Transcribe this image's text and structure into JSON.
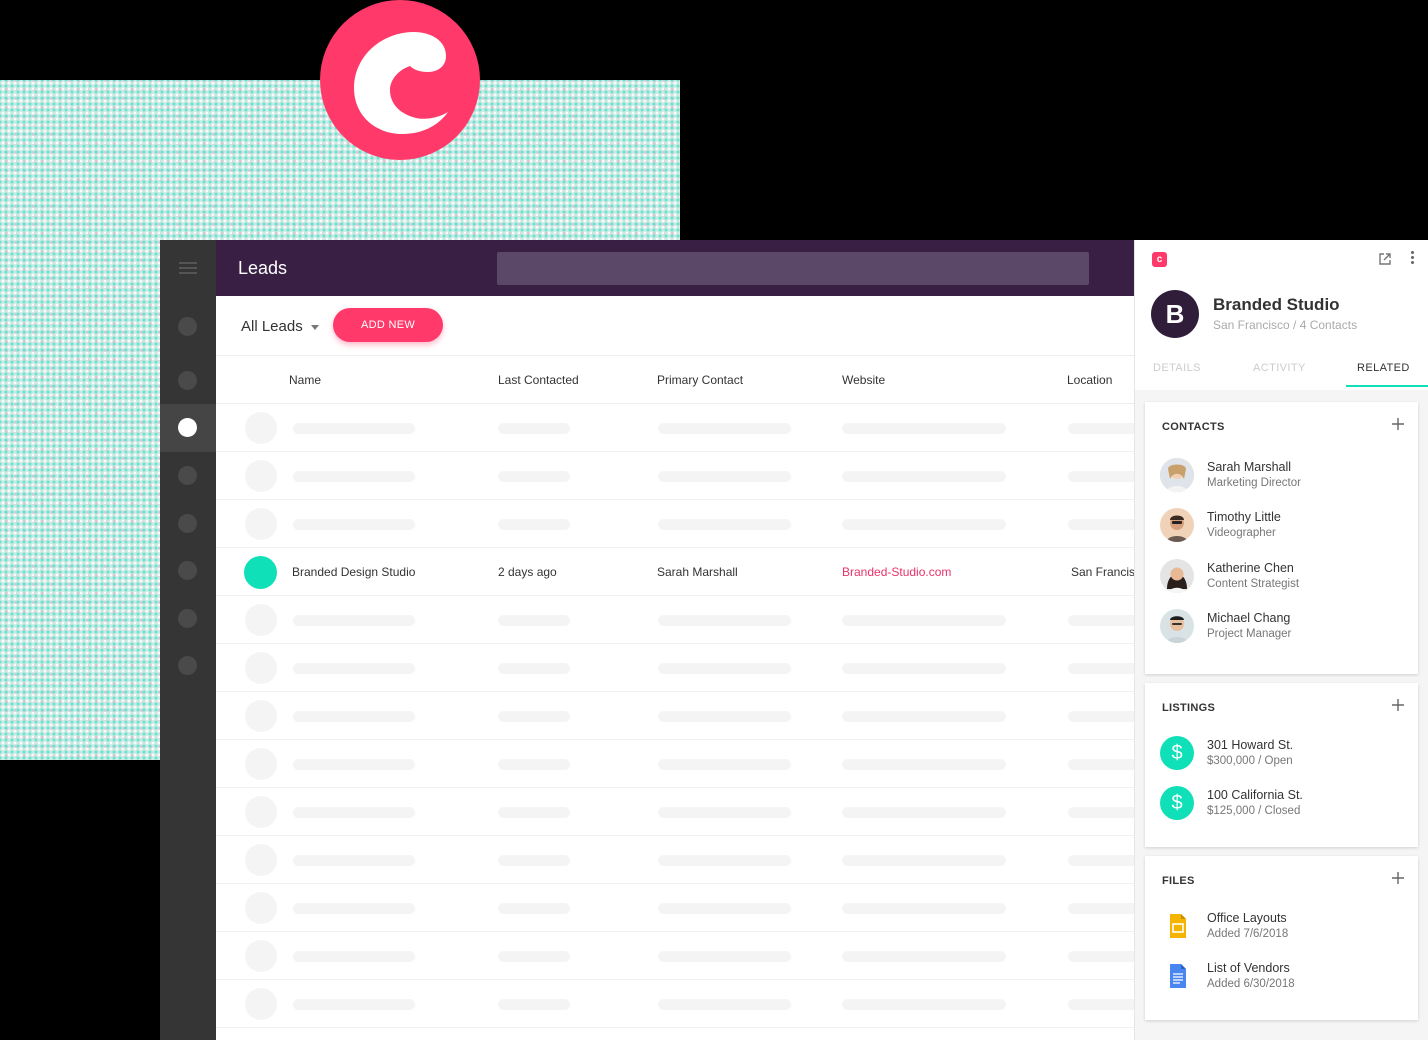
{
  "brand": {
    "logo_icon": "coppercrm-logo-icon",
    "accent": "#ff3a6a",
    "teal": "#0fe0b8",
    "topbar": "#3a1f45"
  },
  "app": {
    "title": "Leads",
    "search": {
      "placeholder": ""
    },
    "filter_label": "All Leads",
    "add_button": "ADD NEW",
    "columns": [
      "Name",
      "Last Contacted",
      "Primary Contact",
      "Website",
      "Location"
    ],
    "lead": {
      "name": "Branded Design Studio",
      "last_contacted": "2 days ago",
      "primary_contact": "Sarah Marshall",
      "website": "Branded-Studio.com",
      "location": "San Francis"
    }
  },
  "panel": {
    "company_initial": "B",
    "company_name": "Branded Studio",
    "company_sub": "San Francisco / 4 Contacts",
    "tabs": [
      "DETAILS",
      "ACTIVITY",
      "RELATED"
    ],
    "active_tab": "RELATED",
    "contacts": {
      "title": "CONTACTS",
      "items": [
        {
          "name": "Sarah Marshall",
          "role": "Marketing Director"
        },
        {
          "name": "Timothy Little",
          "role": "Videographer"
        },
        {
          "name": "Katherine Chen",
          "role": "Content Strategist"
        },
        {
          "name": "Michael Chang",
          "role": "Project Manager"
        }
      ]
    },
    "listings": {
      "title": "LISTINGS",
      "items": [
        {
          "name": "301 Howard St.",
          "detail": "$300,000 / Open"
        },
        {
          "name": "100 California St.",
          "detail": "$125,000 / Closed"
        }
      ]
    },
    "files": {
      "title": "FILES",
      "items": [
        {
          "name": "Office Layouts",
          "detail": "Added 7/6/2018",
          "icon": "google-slides-icon"
        },
        {
          "name": "List of Vendors",
          "detail": "Added 6/30/2018",
          "icon": "google-docs-icon"
        }
      ]
    },
    "dollar_glyph": "$"
  }
}
